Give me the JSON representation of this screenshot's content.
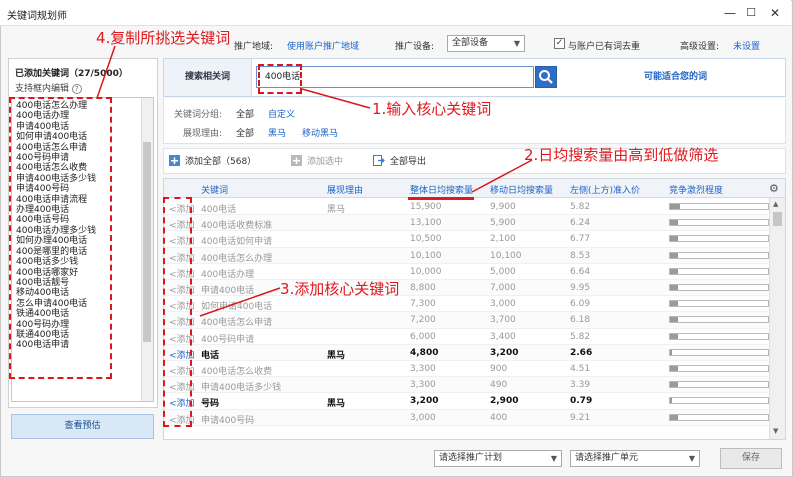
{
  "window": {
    "title": "关键词规划师",
    "minimize": "—",
    "maximize": "☐",
    "close": "✕"
  },
  "settings": {
    "region_label": "推广地域:",
    "region_value": "使用账户推广地域",
    "device_label": "推广设备:",
    "device_value": "全部设备",
    "dedupe_label": "与账户已有词去重",
    "dedupe_checked": true,
    "advanced_label": "高级设置:",
    "advanced_value": "未设置"
  },
  "left_panel": {
    "header": "已添加关键词（27/5000）",
    "sub": "支持框内编辑",
    "help_icon": "?",
    "keywords": [
      "400电话怎么办理",
      "400电话办理",
      "申请400电话",
      "如何申请400电话",
      "400电话怎么申请",
      "400号码申请",
      "400电话怎么收费",
      "申请400电话多少钱",
      "申请400号码",
      "400电话申请流程",
      "办理400电话",
      "400电话号码",
      "400电话办理多少钱",
      "如何办理400电话",
      "400是哪里的电话",
      "400电话多少钱",
      "400电话哪家好",
      "400电话靓号",
      "移动400电话",
      "怎么申请400电话",
      "铁通400电话",
      "400号码办理",
      "联通400电话",
      "400电话申请"
    ],
    "preview_button": "查看预估"
  },
  "search": {
    "label": "搜索相关词",
    "value": "400电话",
    "link": "可能适合您的词"
  },
  "filters": {
    "group_label": "关键词分组:",
    "group_options": [
      "全部",
      "自定义"
    ],
    "reason_label": "展现理由:",
    "reason_options": [
      "全部",
      "黑马",
      "移动黑马"
    ]
  },
  "toolbar": {
    "add_all": "添加全部（568）",
    "add_selected": "添加选中",
    "export_all": "全部导出"
  },
  "table": {
    "columns": [
      "关键词",
      "展现理由",
      "整体日均搜索量",
      "移动日均搜索量",
      "左侧(上方)准入价",
      "竞争激烈程度"
    ],
    "add_label": "<添加",
    "rows": [
      {
        "keyword": "400电话",
        "reason": "黑马",
        "total": "15,900",
        "mobile": "9,900",
        "price": "5.82",
        "competition": 0.1,
        "hot": false
      },
      {
        "keyword": "400电话收费标准",
        "reason": "",
        "total": "13,100",
        "mobile": "5,900",
        "price": "6.24",
        "competition": 0.08,
        "hot": false
      },
      {
        "keyword": "400电话如何申请",
        "reason": "",
        "total": "10,500",
        "mobile": "2,100",
        "price": "6.77",
        "competition": 0.08,
        "hot": false
      },
      {
        "keyword": "400电话怎么办理",
        "reason": "",
        "total": "10,100",
        "mobile": "10,100",
        "price": "8.53",
        "competition": 0.08,
        "hot": false
      },
      {
        "keyword": "400电话办理",
        "reason": "",
        "total": "10,000",
        "mobile": "5,000",
        "price": "6.64",
        "competition": 0.08,
        "hot": false
      },
      {
        "keyword": "申请400电话",
        "reason": "",
        "total": "8,800",
        "mobile": "7,000",
        "price": "9.95",
        "competition": 0.08,
        "hot": false
      },
      {
        "keyword": "如何申请400电话",
        "reason": "",
        "total": "7,300",
        "mobile": "3,000",
        "price": "6.09",
        "competition": 0.08,
        "hot": false
      },
      {
        "keyword": "400电话怎么申请",
        "reason": "",
        "total": "7,200",
        "mobile": "3,700",
        "price": "6.18",
        "competition": 0.08,
        "hot": false
      },
      {
        "keyword": "400号码申请",
        "reason": "",
        "total": "6,000",
        "mobile": "3,400",
        "price": "5.82",
        "competition": 0.08,
        "hot": false
      },
      {
        "keyword": "电话",
        "reason": "黑马",
        "total": "4,800",
        "mobile": "3,200",
        "price": "2.66",
        "competition": 0.02,
        "hot": true
      },
      {
        "keyword": "400电话怎么收费",
        "reason": "",
        "total": "3,300",
        "mobile": "900",
        "price": "4.51",
        "competition": 0.08,
        "hot": false
      },
      {
        "keyword": "申请400电话多少钱",
        "reason": "",
        "total": "3,300",
        "mobile": "490",
        "price": "3.39",
        "competition": 0.08,
        "hot": false
      },
      {
        "keyword": "号码",
        "reason": "黑马",
        "total": "3,200",
        "mobile": "2,900",
        "price": "0.79",
        "competition": 0.02,
        "hot": true
      },
      {
        "keyword": "申请400号码",
        "reason": "",
        "total": "3,000",
        "mobile": "400",
        "price": "9.21",
        "competition": 0.08,
        "hot": false
      }
    ]
  },
  "footer": {
    "plan_select": "请选择推广计划",
    "unit_select": "请选择推广单元",
    "save": "保存"
  },
  "annotations": {
    "a1": "1.输入核心关键词",
    "a2": "2.日均搜索量由高到低做筛选",
    "a3": "3.添加核心关键词",
    "a4": "4.复制所挑选关键词"
  }
}
